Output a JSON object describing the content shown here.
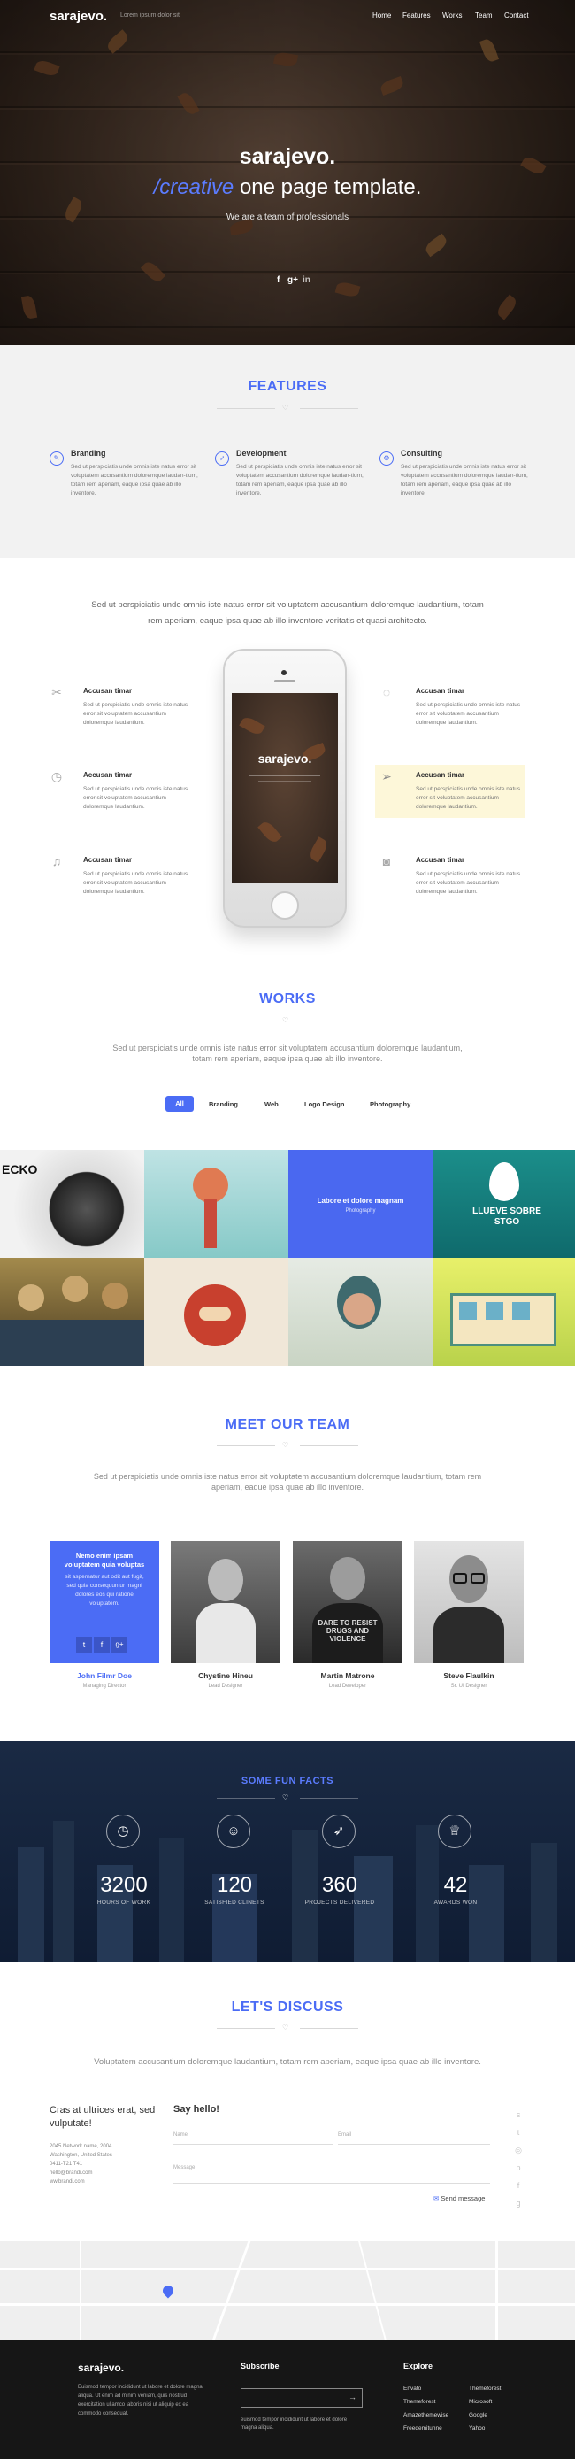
{
  "header": {
    "logo": "sarajevo.",
    "tagline": "Lorem ipsum dolor sit",
    "nav": [
      "Home",
      "Features",
      "Works",
      "Team",
      "Contact"
    ]
  },
  "hero": {
    "title": "sarajevo.",
    "subtitle_accent": "/creative",
    "subtitle_rest": "one page template.",
    "tagline": "We are a team of professionals",
    "social": [
      "f",
      "g+",
      "in"
    ]
  },
  "features": {
    "title": "FEATURES",
    "items": [
      {
        "icon": "pencil-icon",
        "title": "Branding",
        "text": "Sed ut perspiciatis unde omnis iste natus error sit voluptatem accusantium doloremque laudan-tium, totam rem aperiam, eaque ipsa quae ab illo inventore."
      },
      {
        "icon": "rocket-icon",
        "title": "Development",
        "text": "Sed ut perspiciatis unde omnis iste natus error sit voluptatem accusantium doloremque laudan-tium, totam rem aperiam, eaque ipsa quae ab illo inventore."
      },
      {
        "icon": "gear-icon",
        "title": "Consulting",
        "text": "Sed ut perspiciatis unde omnis iste natus error sit voluptatem accusantium doloremque laudan-tium, totam rem aperiam, eaque ipsa quae ab illo inventore."
      }
    ]
  },
  "services": {
    "lead": "Sed ut perspiciatis unde omnis iste natus error sit voluptatem accusantium doloremque laudantium, totam rem aperiam, eaque ipsa quae ab illo inventore veritatis et quasi architecto.",
    "left": [
      {
        "icon": "tools-icon",
        "title": "Accusan timar",
        "text": "Sed ut perspiciatis unde omnis iste natus error sit voluptatem accusantium doloremque laudantium."
      },
      {
        "icon": "clock-icon",
        "title": "Accusan timar",
        "text": "Sed ut perspiciatis unde omnis iste natus error sit voluptatem accusantium doloremque laudantium."
      },
      {
        "icon": "music-icon",
        "title": "Accusan timar",
        "text": "Sed ut perspiciatis unde omnis iste natus error sit voluptatem accusantium doloremque laudantium."
      }
    ],
    "right": [
      {
        "icon": "lightbulb-icon",
        "title": "Accusan timar",
        "text": "Sed ut perspiciatis unde omnis iste natus error sit voluptatem accusantium doloremque laudantium."
      },
      {
        "icon": "paper-plane-icon",
        "title": "Accusan timar",
        "text": "Sed ut perspiciatis unde omnis iste natus error sit voluptatem accusantium doloremque laudantium."
      },
      {
        "icon": "camera-icon",
        "title": "Accusan timar",
        "text": "Sed ut perspiciatis unde omnis iste natus error sit voluptatem accusantium doloremque laudantium."
      }
    ],
    "phone_logo": "sarajevo."
  },
  "works": {
    "title": "WORKS",
    "lead": "Sed ut perspiciatis unde omnis iste natus error sit voluptatem accusantium doloremque laudantium, totam rem aperiam, eaque ipsa quae ab illo inventore.",
    "filters": [
      "All",
      "Branding",
      "Web",
      "Logo Design",
      "Photography"
    ],
    "hover_title": "Labore et dolore magnam",
    "hover_sub": "Photography",
    "tile_text_1": "ECKO",
    "tile_text_2": "LLUEVE SOBRE STGO"
  },
  "team": {
    "title": "MEET OUR TEAM",
    "lead": "Sed ut perspiciatis unde omnis iste natus error sit voluptatem accusantium doloremque laudantium, totam rem aperiam, eaque ipsa quae ab illo inventore.",
    "hover_title": "Nemo enim ipsam voluptatem quia voluptas",
    "hover_text": "sit aspernatur aut odit aut fugit, sed quia consequuntur magni dolores eos qui ratione voluptatem.",
    "members": [
      {
        "name": "John Filmr Doe",
        "role": "Managing Director"
      },
      {
        "name": "Chystine Hineu",
        "role": "Lead Designer"
      },
      {
        "name": "Martin Matrone",
        "role": "Lead Developer"
      },
      {
        "name": "Steve Flaulkin",
        "role": "Sr. UI Designer"
      }
    ],
    "shirt_text": "DARE TO RESIST DRUGS AND VIOLENCE"
  },
  "facts": {
    "title": "SOME FUN FACTS",
    "items": [
      {
        "icon": "clock-icon",
        "value": "3200",
        "label": "HOURS OF WORK"
      },
      {
        "icon": "users-icon",
        "value": "120",
        "label": "SATISFIED CLINETS"
      },
      {
        "icon": "rocket-icon",
        "value": "360",
        "label": "PROJECTS DELIVERED"
      },
      {
        "icon": "trophy-icon",
        "value": "42",
        "label": "AWARDS WON"
      }
    ]
  },
  "contact": {
    "title": "LET'S DISCUSS",
    "lead": "Voluptatem accusantium doloremque laudantium, totam rem aperiam, eaque ipsa quae ab illo inventore.",
    "intro": "Cras at ultrices erat, sed vulputate!",
    "address": [
      "2045 Network name, 2004",
      "Washington, United States",
      "0411-T21 T41",
      "hello@brandi.com",
      "ww.brandi.com"
    ],
    "form_title": "Say hello!",
    "name_label": "Name",
    "email_label": "Email",
    "message_label": "Message",
    "send_label": "Send message",
    "side_icons": [
      "skype-icon",
      "twitter-icon",
      "dribbble-icon",
      "pinterest-icon",
      "facebook-icon",
      "google-plus-icon"
    ]
  },
  "footer": {
    "logo": "sarajevo.",
    "about": "Euismod tempor incididunt ut labore et dolore magna aliqua. Ut enim ad minim veniam, quis nostrud exercitation ullamco laboris nisi ut aliquip ex ea commodo consequat.",
    "subscribe_title": "Subscribe",
    "subscribe_text": "euismod tempor incididunt ut labore et dolore magna aliqua.",
    "explore_title": "Explore",
    "links_col1": [
      "Envato",
      "Themeforest",
      "Amazethemewise",
      "Freedemitunne"
    ],
    "links_col2": [
      "Themeforest",
      "Microsoft",
      "Google",
      "Yahoo"
    ]
  }
}
